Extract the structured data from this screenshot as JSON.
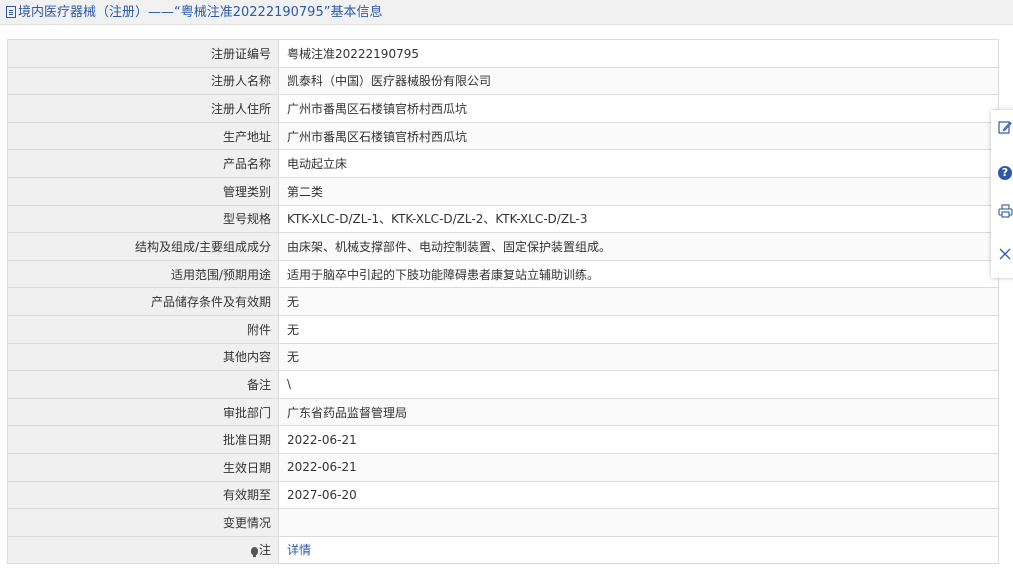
{
  "header": {
    "icon": "document-icon",
    "title": "境内医疗器械（注册）——“粤械注准20222190795”基本信息"
  },
  "rows": [
    {
      "label": "注册证编号",
      "value": "粤械注准20222190795"
    },
    {
      "label": "注册人名称",
      "value": "凯泰科（中国）医疗器械股份有限公司"
    },
    {
      "label": "注册人住所",
      "value": "广州市番禺区石楼镇官桥村西瓜坑"
    },
    {
      "label": "生产地址",
      "value": "广州市番禺区石楼镇官桥村西瓜坑"
    },
    {
      "label": "产品名称",
      "value": "电动起立床"
    },
    {
      "label": "管理类别",
      "value": "第二类"
    },
    {
      "label": "型号规格",
      "value": "KTK-XLC-D/ZL-1、KTK-XLC-D/ZL-2、KTK-XLC-D/ZL-3"
    },
    {
      "label": "结构及组成/主要组成成分",
      "value": "由床架、机械支撑部件、电动控制装置、固定保护装置组成。"
    },
    {
      "label": "适用范围/预期用途",
      "value": "适用于脑卒中引起的下肢功能障碍患者康复站立辅助训练。"
    },
    {
      "label": "产品储存条件及有效期",
      "value": "无"
    },
    {
      "label": "附件",
      "value": "无"
    },
    {
      "label": "其他内容",
      "value": "无"
    },
    {
      "label": "备注",
      "value": "\\"
    },
    {
      "label": "审批部门",
      "value": "广东省药品监督管理局"
    },
    {
      "label": "批准日期",
      "value": "2022-06-21"
    },
    {
      "label": "生效日期",
      "value": "2022-06-21"
    },
    {
      "label": "有效期至",
      "value": "2027-06-20"
    },
    {
      "label": "变更情况",
      "value": ""
    }
  ],
  "note_row": {
    "label": "注",
    "icon": "lightbulb-icon",
    "link": "详情"
  },
  "side_panel": {
    "buttons": [
      "edit-icon",
      "help-icon",
      "print-icon",
      "close-icon"
    ],
    "help_glyph": "?"
  },
  "colors": {
    "accent": "#2d5aa8",
    "label_bg": "#f0f0f0",
    "border": "#dcdcdc"
  }
}
